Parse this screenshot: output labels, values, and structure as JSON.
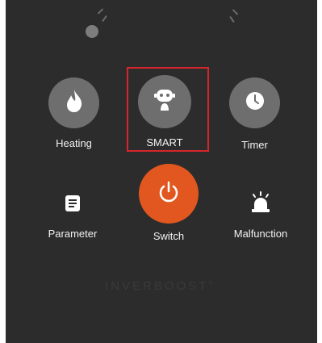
{
  "buttons": {
    "heating": {
      "label": "Heating",
      "icon": "flame-icon"
    },
    "smart": {
      "label": "SMART",
      "icon": "robot-icon",
      "selected": true
    },
    "timer": {
      "label": "Timer",
      "icon": "clock-icon"
    },
    "parameter": {
      "label": "Parameter",
      "icon": "document-icon"
    },
    "switch": {
      "label": "Switch",
      "icon": "power-icon"
    },
    "malfunction": {
      "label": "Malfunction",
      "icon": "alarm-light-icon"
    }
  },
  "brand": {
    "text": "INVERBOOST",
    "mark": "®"
  },
  "colors": {
    "panel_bg": "#2c2c2c",
    "button_gray": "#6e6e6e",
    "switch_orange": "#e1571f",
    "selection_red": "#d6262c",
    "text": "#f2f2f2"
  }
}
